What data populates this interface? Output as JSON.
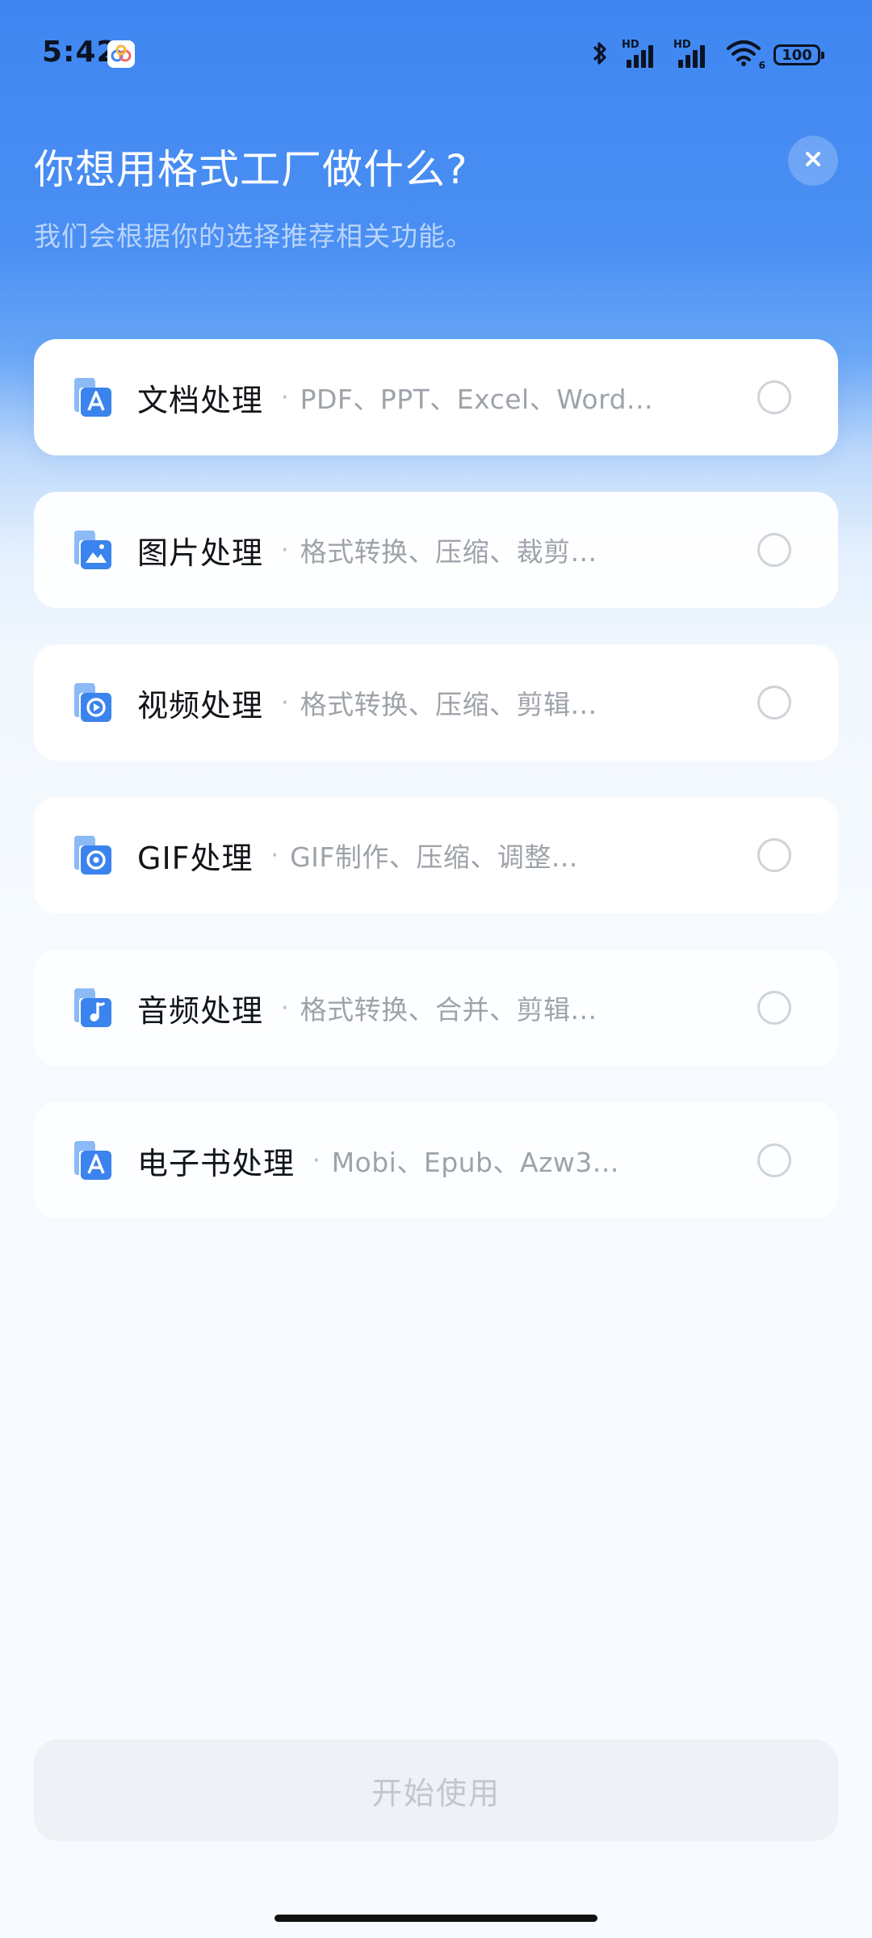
{
  "status_bar": {
    "time": "5:42",
    "app_icon": "format-factory-mini-icon",
    "bluetooth_icon": "bluetooth-icon",
    "signal_1_label": "HD",
    "signal_2_label": "HD",
    "wifi_icon": "wifi-icon",
    "wifi_label": "6",
    "battery": "100"
  },
  "header": {
    "title": "你想用格式工厂做什么?",
    "subtitle": "我们会根据你的选择推荐相关功能。",
    "close_icon": "close-icon"
  },
  "options": [
    {
      "title": "文档处理",
      "separator": "·",
      "desc": "PDF、PPT、Excel、Word...",
      "icon": "document-icon",
      "selected": false
    },
    {
      "title": "图片处理",
      "separator": "·",
      "desc": "格式转换、压缩、裁剪...",
      "icon": "image-icon",
      "selected": false
    },
    {
      "title": "视频处理",
      "separator": "·",
      "desc": "格式转换、压缩、剪辑...",
      "icon": "video-icon",
      "selected": false
    },
    {
      "title": "GIF处理",
      "separator": "·",
      "desc": "GIF制作、压缩、调整...",
      "icon": "gif-icon",
      "selected": false
    },
    {
      "title": "音频处理",
      "separator": "·",
      "desc": "格式转换、合并、剪辑...",
      "icon": "audio-icon",
      "selected": false
    },
    {
      "title": "电子书处理",
      "separator": "·",
      "desc": "Mobi、Epub、Azw3...",
      "icon": "ebook-icon",
      "selected": false
    }
  ],
  "start_button": {
    "label": "开始使用",
    "enabled": false
  },
  "colors": {
    "accent": "#3f86f1",
    "icon_dark": "#3b83ee",
    "icon_light": "#8cbaf7",
    "radio_border": "#cfd3d8",
    "disabled_button": "#eef1f5"
  }
}
